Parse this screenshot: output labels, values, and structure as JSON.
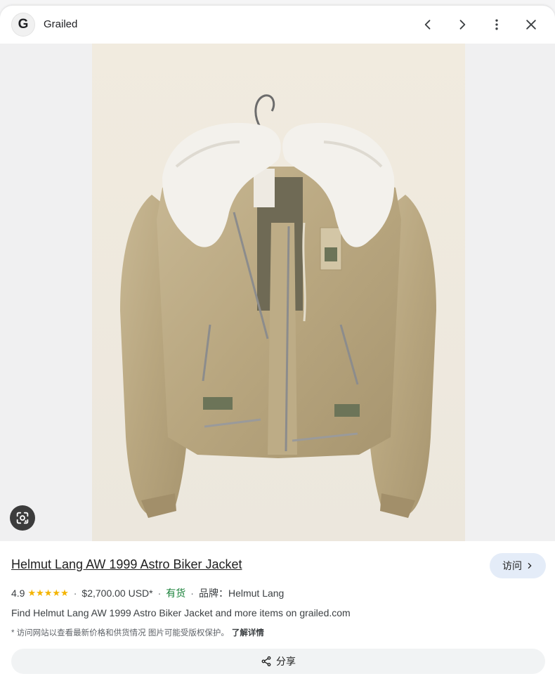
{
  "header": {
    "site_logo_letter": "G",
    "site_name": "Grailed",
    "icons": [
      "chevron-left-icon",
      "chevron-right-icon",
      "more-vert-icon",
      "close-icon"
    ]
  },
  "image": {
    "lens_icon": "lens-icon"
  },
  "product": {
    "title": "Helmut Lang AW 1999 Astro Biker Jacket",
    "visit_label": "访问",
    "rating": "4.9",
    "stars": "★★★★★",
    "price": "$2,700.00 USD*",
    "stock": "有货",
    "brand_label": "品牌：",
    "brand": "Helmut Lang",
    "sep": "·",
    "description": "Find Helmut Lang AW 1999 Astro Biker Jacket and more items on grailed.com",
    "note": "* 访问网站以查看最新价格和供货情况 图片可能受版权保护。",
    "learn_more": "了解详情",
    "share_label": "分享"
  },
  "colors": {
    "stock_green": "#188038",
    "star_gold": "#f4b400",
    "visit_bg": "#e4ecf8"
  }
}
